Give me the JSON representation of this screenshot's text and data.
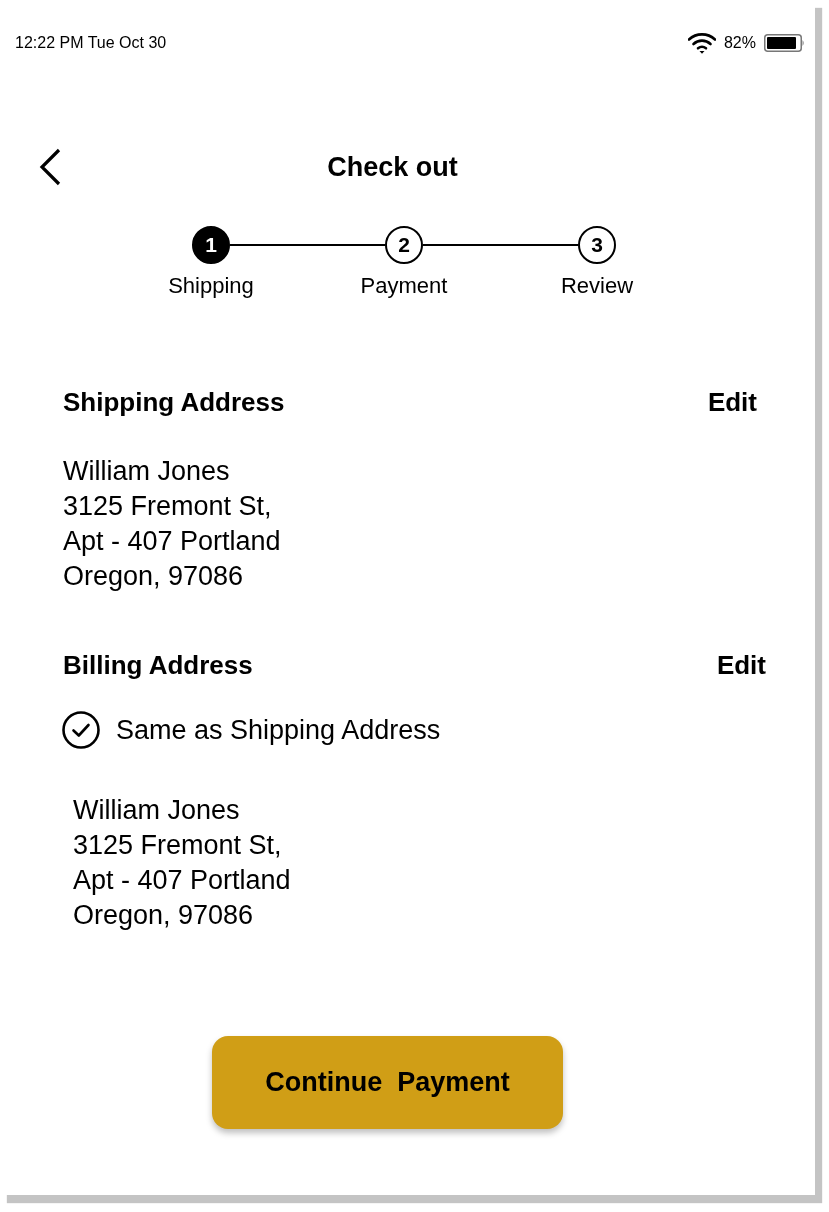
{
  "status_bar": {
    "time": "12:22 PM Tue Oct 30",
    "battery": "82%"
  },
  "header": {
    "title": "Check out"
  },
  "steps": [
    {
      "number": "1",
      "label": "Shipping",
      "selected": true
    },
    {
      "number": "2",
      "label": "Payment",
      "selected": false
    },
    {
      "number": "3",
      "label": "Review",
      "selected": false
    }
  ],
  "shipping_address": {
    "title": "Shipping Address",
    "edit": "Edit",
    "lines": [
      "William Jones",
      "3125 Fremont St,",
      "Apt - 407 Portland",
      "Oregon, 97086"
    ]
  },
  "billing_address": {
    "title": "Billing Address",
    "edit": "Edit",
    "same_as_shipping": {
      "label": "Same as Shipping Address",
      "checked": true
    },
    "lines": [
      "William Jones",
      "3125 Fremont St,",
      "Apt - 407 Portland",
      "Oregon, 97086"
    ]
  },
  "continue_button": {
    "label": "Continue  Payment"
  }
}
